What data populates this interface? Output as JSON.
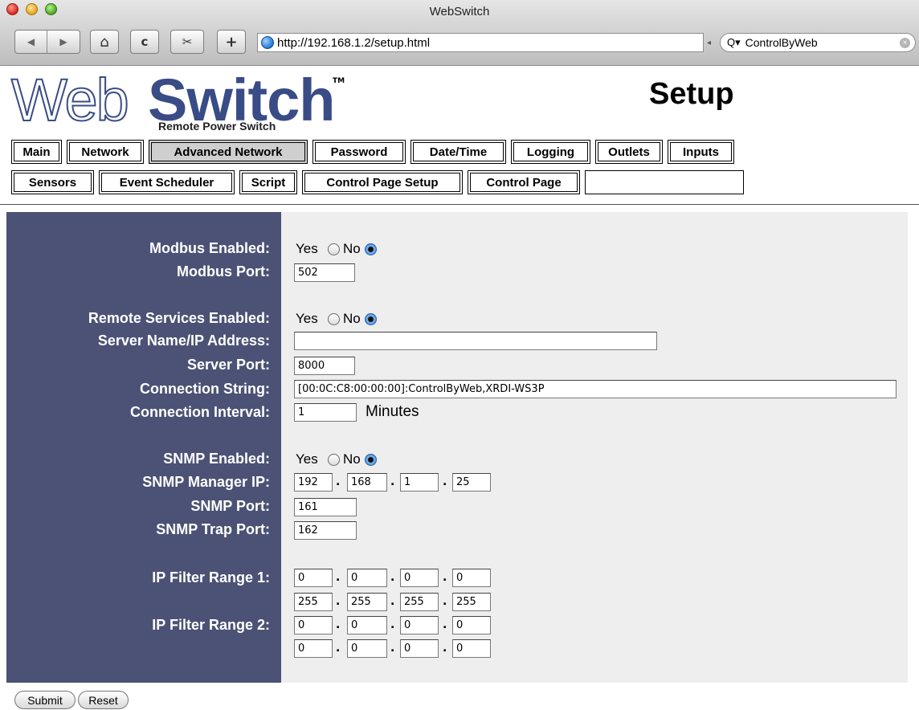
{
  "window": {
    "title": "WebSwitch"
  },
  "toolbar": {
    "back_icon": "◀",
    "forward_icon": "▶",
    "home_icon": "⌂",
    "reload_icon": "c",
    "snapback_icon": "✂",
    "add_icon": "+",
    "url": "http://192.168.1.2/setup.html",
    "search_value": "ControlByWeb",
    "search_prefix": "Q▾",
    "clear_icon": "×"
  },
  "header": {
    "logo_web": "Web",
    "logo_switch": "Switch",
    "logo_tm": "TM",
    "logo_subtitle": "Remote Power Switch",
    "page_title": "Setup"
  },
  "menu": {
    "row1": [
      "Main",
      "Network",
      "Advanced Network",
      "Password",
      "Date/Time",
      "Logging",
      "Outlets",
      "Inputs"
    ],
    "row2": [
      "Sensors",
      "Event Scheduler",
      "Script",
      "Control Page Setup",
      "Control Page"
    ],
    "active": "Advanced Network"
  },
  "form": {
    "modbus_enabled_label": "Modbus Enabled:",
    "modbus_port_label": "Modbus Port:",
    "modbus_port": "502",
    "modbus_enabled": "No",
    "remote_enabled_label": "Remote Services Enabled:",
    "remote_enabled": "No",
    "server_name_label": "Server Name/IP Address:",
    "server_name": "",
    "server_port_label": "Server Port:",
    "server_port": "8000",
    "connection_string_label": "Connection String:",
    "connection_string": "[00:0C:C8:00:00:00]:ControlByWeb,XRDI-WS3P",
    "connection_interval_label": "Connection Interval:",
    "connection_interval": "1",
    "minutes_unit": "Minutes",
    "snmp_enabled_label": "SNMP Enabled:",
    "snmp_enabled": "No",
    "snmp_manager_ip_label": "SNMP Manager IP:",
    "snmp_manager_ip": [
      "192",
      "168",
      "1",
      "25"
    ],
    "snmp_port_label": "SNMP Port:",
    "snmp_port": "161",
    "snmp_trap_port_label": "SNMP Trap Port:",
    "snmp_trap_port": "162",
    "ip_filter_1_label": "IP Filter Range 1:",
    "ip_filter_1_start": [
      "0",
      "0",
      "0",
      "0"
    ],
    "ip_filter_1_end": [
      "255",
      "255",
      "255",
      "255"
    ],
    "ip_filter_2_label": "IP Filter Range 2:",
    "ip_filter_2_start": [
      "0",
      "0",
      "0",
      "0"
    ],
    "ip_filter_2_end": [
      "0",
      "0",
      "0",
      "0"
    ],
    "yes_label": "Yes",
    "no_label": "No",
    "dot": "."
  },
  "buttons": {
    "submit": "Submit",
    "reset": "Reset"
  }
}
